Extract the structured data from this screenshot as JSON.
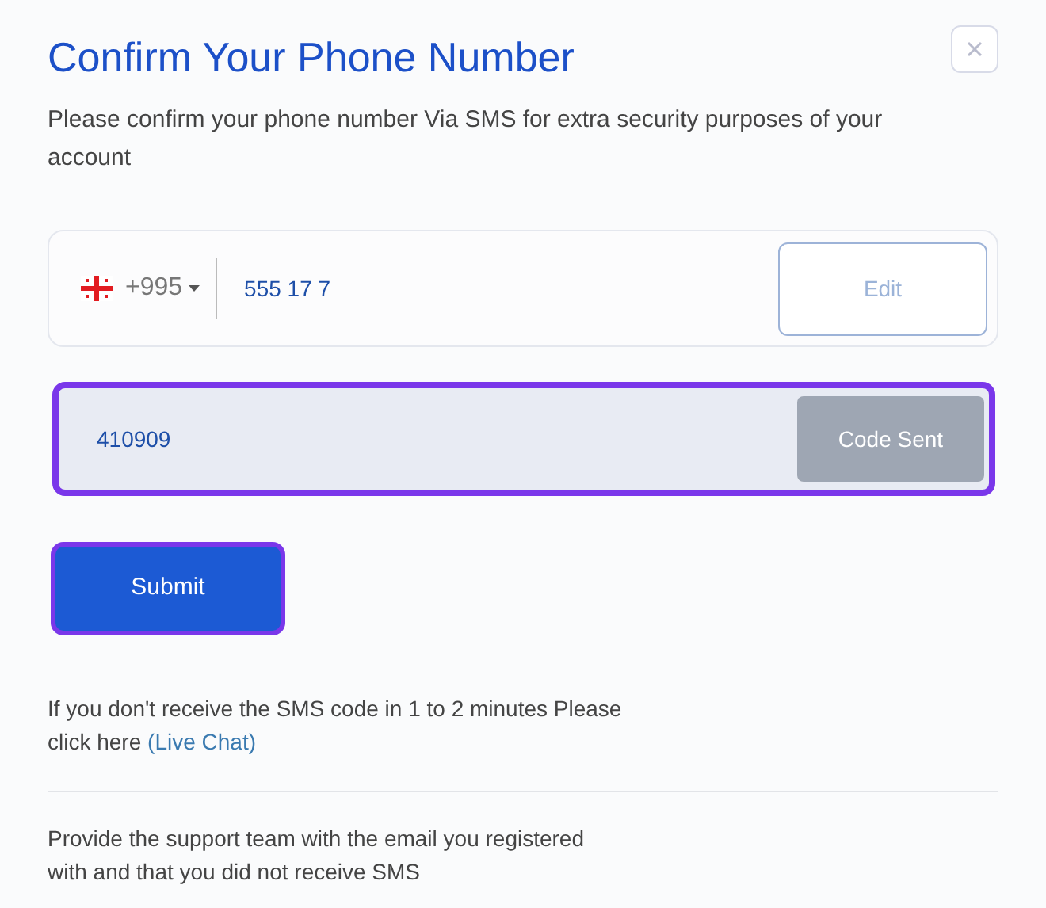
{
  "title": "Confirm Your Phone Number",
  "subtitle": "Please confirm your phone number Via SMS for extra security purposes of your account",
  "phone": {
    "country_code": "+995",
    "number": "555 17 7",
    "edit_button": "Edit"
  },
  "code": {
    "value": "410909",
    "button": "Code Sent",
    "disabled": true,
    "highlighted": true
  },
  "submit": {
    "label": "Submit",
    "highlighted": true
  },
  "help": {
    "text": "If you don't receive the SMS code in 1 to 2 minutes Please click here",
    "link": "(Live Chat)"
  },
  "support_text": "Provide the support team with the email you registered with and that you did not receive SMS"
}
